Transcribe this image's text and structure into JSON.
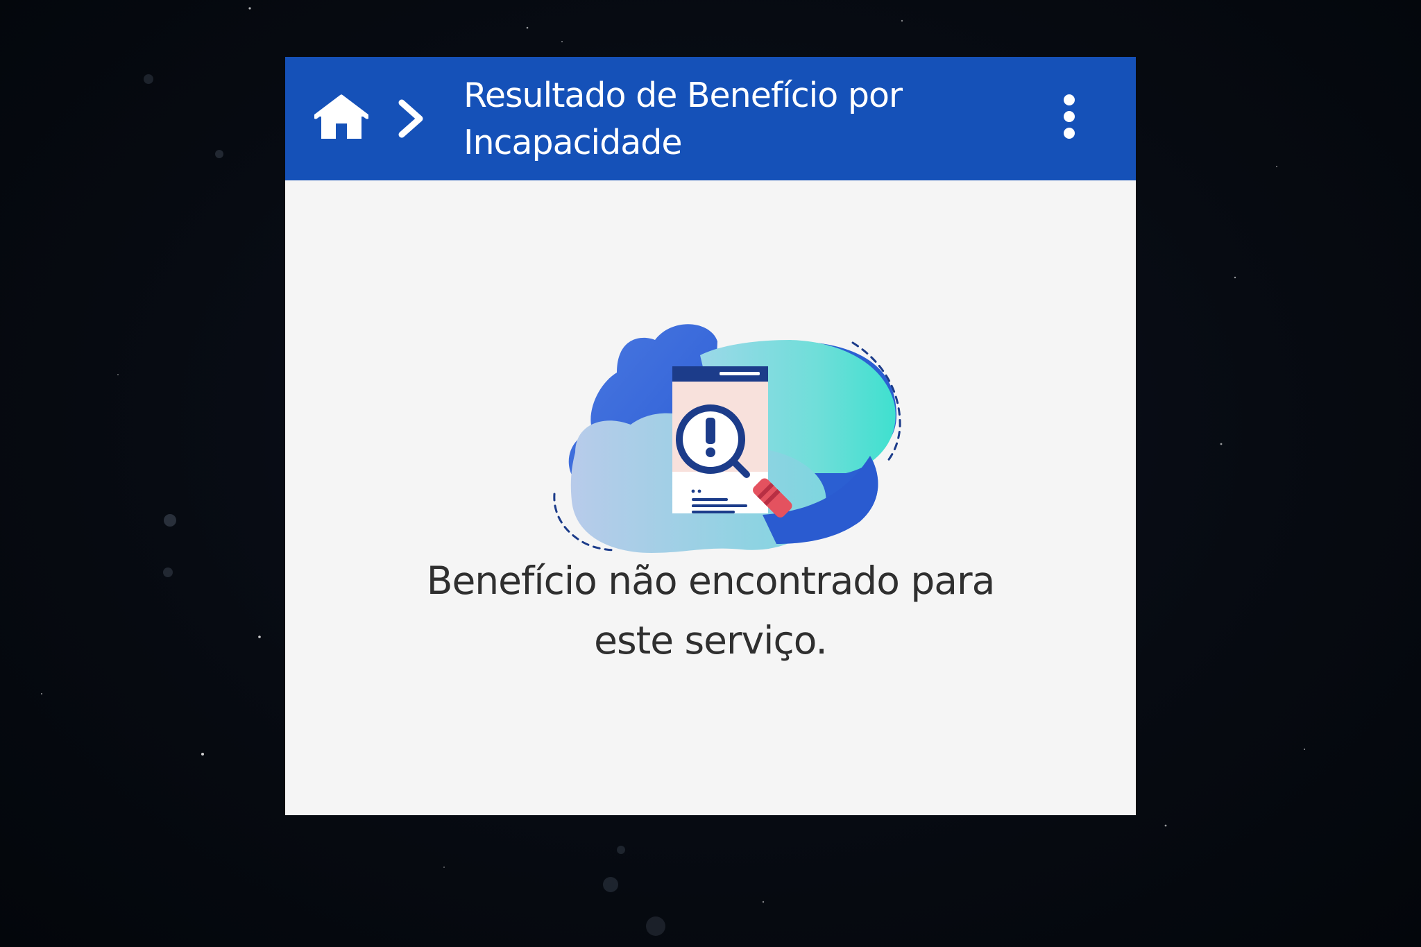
{
  "header": {
    "title_line1": "Resultado de Benefício por",
    "title_line2": "Incapacidade",
    "home_icon": "home-icon",
    "breadcrumb_separator_icon": "chevron-right-icon",
    "menu_icon": "more-vertical-icon"
  },
  "empty_state": {
    "illustration": "document-search-warning-illustration",
    "message_line1": "Benefício não encontrado para",
    "message_line2": "este serviço."
  },
  "colors": {
    "appbar": "#1551b8",
    "panel_background": "#f5f5f5",
    "message_text": "#2f2f2f",
    "page_background": "#070b12"
  }
}
